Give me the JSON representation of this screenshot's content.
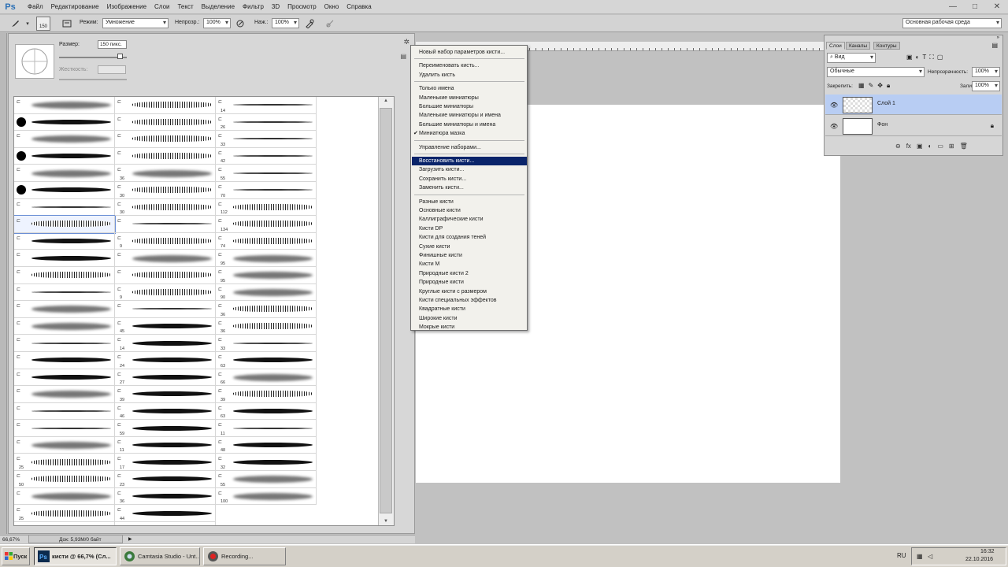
{
  "app": {
    "logo": "Ps"
  },
  "menubar": {
    "items": [
      "Файл",
      "Редактирование",
      "Изображение",
      "Слои",
      "Текст",
      "Выделение",
      "Фильтр",
      "3D",
      "Просмотр",
      "Окно",
      "Справка"
    ],
    "window_controls": [
      "—",
      "□",
      "✕"
    ]
  },
  "options": {
    "brush_size": "150",
    "mode_label": "Режим:",
    "mode_value": "Умножение",
    "opacity_label": "Непрозр.:",
    "opacity_value": "100%",
    "flow_label": "Наж.:",
    "flow_value": "100%",
    "workspace": "Основная рабочая среда"
  },
  "brush_panel": {
    "size_label": "Размер:",
    "size_value": "150 пикс.",
    "hardness_label": "Жесткость:",
    "col2_sizes": [
      "",
      "",
      "",
      "",
      "36",
      "30",
      "30",
      "",
      "9",
      "",
      "",
      "9",
      "",
      "45",
      "14",
      "24",
      "27",
      "39",
      "46",
      "59",
      "11",
      "17",
      "23",
      "36",
      "44",
      ""
    ],
    "col3_sizes": [
      "14",
      "26",
      "33",
      "42",
      "55",
      "70",
      "112",
      "134",
      "74",
      "95",
      "95",
      "90",
      "36",
      "36",
      "33",
      "63",
      "66",
      "39",
      "63",
      "11",
      "48",
      "32",
      "55",
      "100"
    ],
    "col1_sizes": [
      "",
      "",
      "",
      "",
      "",
      "",
      "",
      "",
      "",
      "",
      "",
      "",
      "",
      "",
      "",
      "",
      "",
      "",
      "",
      "",
      "",
      "25",
      "50",
      "",
      "25",
      ""
    ]
  },
  "flyout": {
    "items": [
      {
        "label": "Новый набор параметров кисти...",
        "type": "item"
      },
      {
        "type": "sep"
      },
      {
        "label": "Переименовать кисть...",
        "type": "item"
      },
      {
        "label": "Удалить кисть",
        "type": "item"
      },
      {
        "type": "sep"
      },
      {
        "label": "Только имена",
        "type": "item"
      },
      {
        "label": "Маленькие миниатюры",
        "type": "item"
      },
      {
        "label": "Большие миниатюры",
        "type": "item"
      },
      {
        "label": "Маленькие миниатюры и имена",
        "type": "item"
      },
      {
        "label": "Большие миниатюры и имена",
        "type": "item"
      },
      {
        "label": "Миниатюра мазка",
        "type": "item",
        "checked": true
      },
      {
        "type": "sep"
      },
      {
        "label": "Управление наборами...",
        "type": "item"
      },
      {
        "type": "sep"
      },
      {
        "label": "Восстановить кисти...",
        "type": "item",
        "selected": true
      },
      {
        "label": "Загрузить кисти...",
        "type": "item"
      },
      {
        "label": "Сохранить кисти...",
        "type": "item"
      },
      {
        "label": "Заменить кисти...",
        "type": "item"
      },
      {
        "type": "sep"
      },
      {
        "label": "Разные кисти",
        "type": "item"
      },
      {
        "label": "Основные кисти",
        "type": "item"
      },
      {
        "label": "Каллиграфические кисти",
        "type": "item"
      },
      {
        "label": "Кисти DP",
        "type": "item"
      },
      {
        "label": "Кисти для создания теней",
        "type": "item"
      },
      {
        "label": "Сухие кисти",
        "type": "item"
      },
      {
        "label": "Финишные кисти",
        "type": "item"
      },
      {
        "label": "Кисти M",
        "type": "item"
      },
      {
        "label": "Природные кисти 2",
        "type": "item"
      },
      {
        "label": "Природные кисти",
        "type": "item"
      },
      {
        "label": "Круглые кисти с размером",
        "type": "item"
      },
      {
        "label": "Кисти специальных эффектов",
        "type": "item"
      },
      {
        "label": "Квадратные кисти",
        "type": "item"
      },
      {
        "label": "Широкие кисти",
        "type": "item"
      },
      {
        "label": "Мокрые кисти",
        "type": "item"
      }
    ]
  },
  "layers_panel": {
    "tabs": [
      "Слои",
      "Каналы",
      "Контуры"
    ],
    "filter": "Вид",
    "blend_mode": "Обычные",
    "opacity_label": "Непрозрачность:",
    "opacity_value": "100%",
    "lock_label": "Закрепить:",
    "fill_label": "Заливка:",
    "fill_value": "100%",
    "layers": [
      {
        "name": "Слой 1",
        "selected": true
      },
      {
        "name": "Фон",
        "locked": true
      }
    ]
  },
  "statusbar": {
    "zoom": "66,67%",
    "doc_info": "Док: 5,93M/0 байт"
  },
  "taskbar": {
    "start": "Пуск",
    "buttons": [
      "кисти @ 66,7% (Сл...",
      "Camtasia Studio - Unt...",
      "Recording..."
    ],
    "lang": "RU",
    "time": "16:32",
    "date": "22.10.2016"
  },
  "colors": {
    "selection": "#0a246a",
    "layer_selected": "#b8cdf3"
  }
}
